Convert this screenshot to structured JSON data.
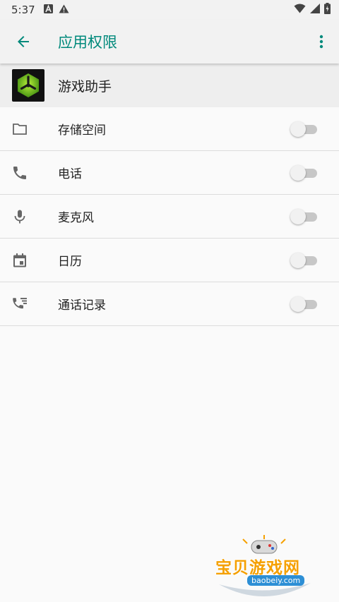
{
  "status_bar": {
    "time": "5:37",
    "icons": [
      "a-notification-icon",
      "warning-icon",
      "wifi-icon",
      "signal-icon",
      "battery-icon"
    ]
  },
  "app_bar": {
    "title": "应用权限",
    "accent_color": "#00897b"
  },
  "app": {
    "name": "游戏助手"
  },
  "permissions": [
    {
      "label": "存储空间",
      "icon": "folder-icon",
      "enabled": false
    },
    {
      "label": "电话",
      "icon": "phone-icon",
      "enabled": false
    },
    {
      "label": "麦克风",
      "icon": "microphone-icon",
      "enabled": false
    },
    {
      "label": "日历",
      "icon": "calendar-icon",
      "enabled": false
    },
    {
      "label": "通话记录",
      "icon": "call-log-icon",
      "enabled": false
    }
  ],
  "watermark": {
    "title": "宝贝游戏网",
    "url": "baobeiy.com"
  }
}
